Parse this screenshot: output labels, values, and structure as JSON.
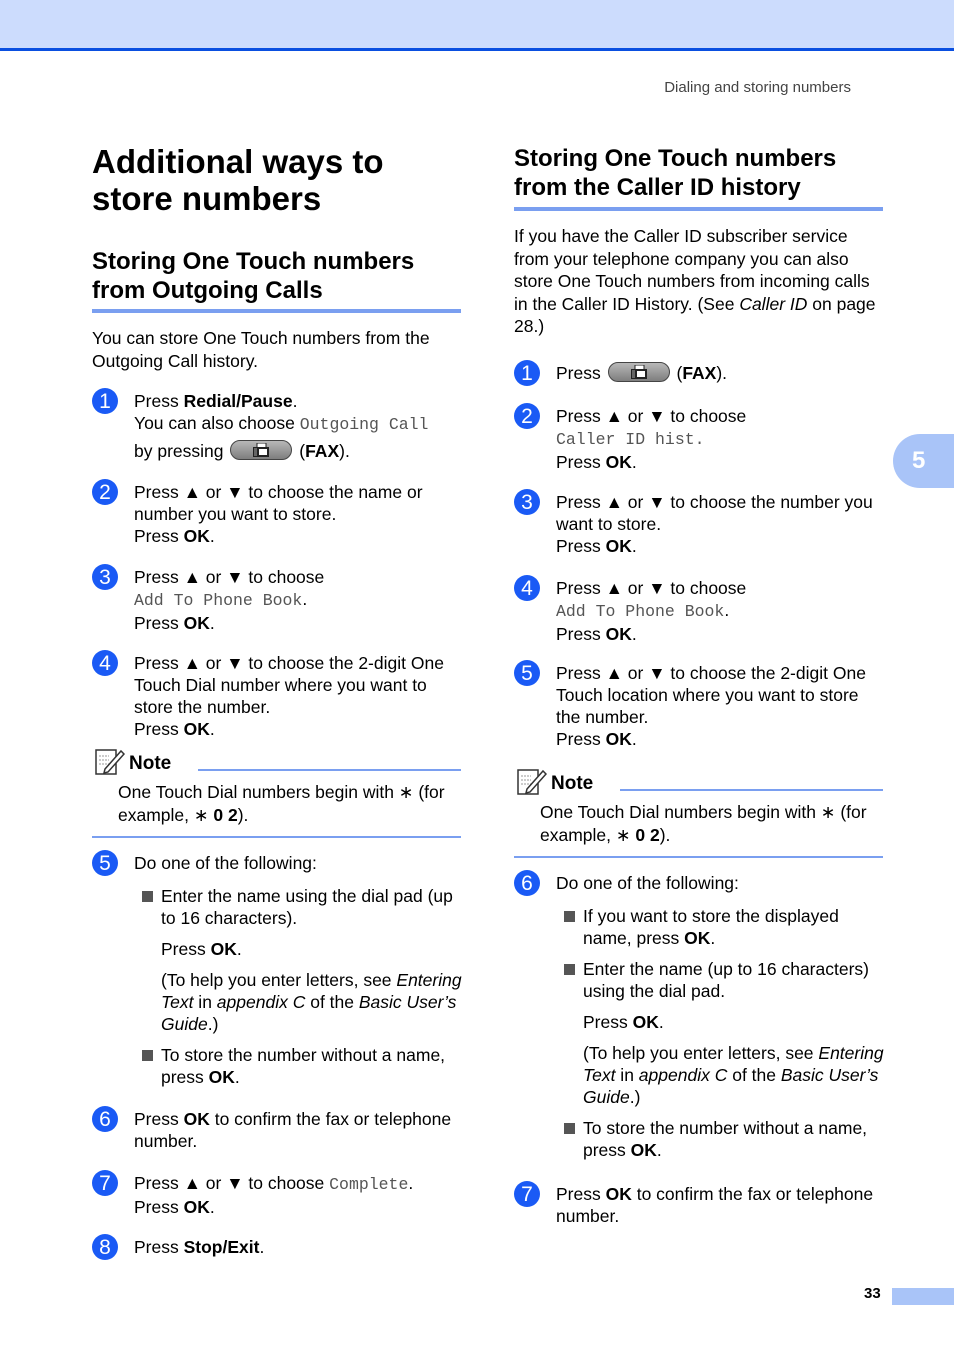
{
  "header": {
    "running_head": "Dialing and storing numbers"
  },
  "chapter_tab": "5",
  "page_number": "33",
  "left": {
    "title": "Additional ways to store numbers",
    "section_title": "Storing One Touch numbers from Outgoing Calls",
    "intro": "You can store One Touch numbers from the Outgoing Call history.",
    "steps": {
      "s1": {
        "num": "1",
        "a": "Press ",
        "b": "Redial/Pause",
        "c": ".",
        "d": "You can also choose ",
        "mono": "Outgoing Call",
        "e": "by pressing",
        "f": "FAX"
      },
      "s2": {
        "num": "2",
        "text": "Press ▲ or ▼ to choose the name or number you want to store.",
        "press": "Press ",
        "ok": "OK",
        "dot": "."
      },
      "s3": {
        "num": "3",
        "text": "Press ▲ or ▼ to choose",
        "mono": "Add To Phone Book",
        "press": "Press ",
        "ok": "OK"
      },
      "s4": {
        "num": "4",
        "text": "Press ▲ or ▼ to choose the 2-digit One Touch Dial number where you want to store the number.",
        "press": "Press ",
        "ok": "OK"
      },
      "s5": {
        "num": "5",
        "text": "Do one of the following:",
        "b1": "Enter the name using the dial pad (up to 16 characters).",
        "b1_press": "Press ",
        "ok": "OK",
        "b1_help_a": "(To help you enter letters, see ",
        "b1_help_i1": "Entering Text",
        "b1_help_b": " in ",
        "b1_help_i2": "appendix C",
        "b1_help_c": " of the ",
        "b1_help_i3": "Basic User’s Guide",
        "b1_help_d": ".)",
        "b2": "To store the number without a name, press "
      },
      "s6": {
        "num": "6",
        "a": "Press ",
        "ok": "OK",
        "b": " to confirm the fax or telephone number."
      },
      "s7": {
        "num": "7",
        "text": "Press ▲ or ▼ to choose ",
        "mono": "Complete",
        "press": "Press ",
        "ok": "OK"
      },
      "s8": {
        "num": "8",
        "a": "Press ",
        "b": "Stop/Exit",
        "c": "."
      }
    },
    "note": {
      "title": "Note",
      "a": "One Touch Dial numbers begin with ∗ (for example, ∗ ",
      "b": "0 2",
      "c": ")."
    }
  },
  "right": {
    "section_title": "Storing One Touch numbers from the Caller ID history",
    "intro_a": "If you have the Caller ID subscriber service from your telephone company you can also store One Touch numbers from incoming calls in the Caller ID History. (See ",
    "intro_i": "Caller ID",
    "intro_b": " on page 28.)",
    "steps": {
      "s1": {
        "num": "1",
        "a": "Press",
        "b": "FAX"
      },
      "s2": {
        "num": "2",
        "text": "Press ▲ or ▼ to choose",
        "mono": "Caller ID hist.",
        "press": "Press ",
        "ok": "OK"
      },
      "s3": {
        "num": "3",
        "text": "Press ▲ or ▼ to choose the number you want to store.",
        "press": "Press ",
        "ok": "OK"
      },
      "s4": {
        "num": "4",
        "text": "Press ▲ or ▼ to choose",
        "mono": "Add To Phone Book",
        "press": "Press ",
        "ok": "OK"
      },
      "s5": {
        "num": "5",
        "text": "Press ▲ or ▼ to choose the 2-digit One Touch location where you want to store the number.",
        "press": "Press ",
        "ok": "OK"
      },
      "s6": {
        "num": "6",
        "text": "Do one of the following:",
        "b1": "If you want to store the displayed name, press ",
        "b2": "Enter the name (up to 16 characters) using the dial pad.",
        "b2_press": "Press ",
        "help_a": "(To help you enter letters, see ",
        "help_i1": "Entering Text",
        "help_b": " in ",
        "help_i2": "appendix C",
        "help_c": " of the ",
        "help_i3": "Basic User’s Guide",
        "help_d": ".)",
        "b3": "To store the number without a name, press ",
        "ok": "OK"
      },
      "s7": {
        "num": "7",
        "a": "Press ",
        "ok": "OK",
        "b": " to confirm the fax or telephone number."
      }
    },
    "note": {
      "title": "Note",
      "a": "One Touch Dial numbers begin with ∗ (for example, ∗ ",
      "b": "0 2",
      "c": ")."
    }
  }
}
